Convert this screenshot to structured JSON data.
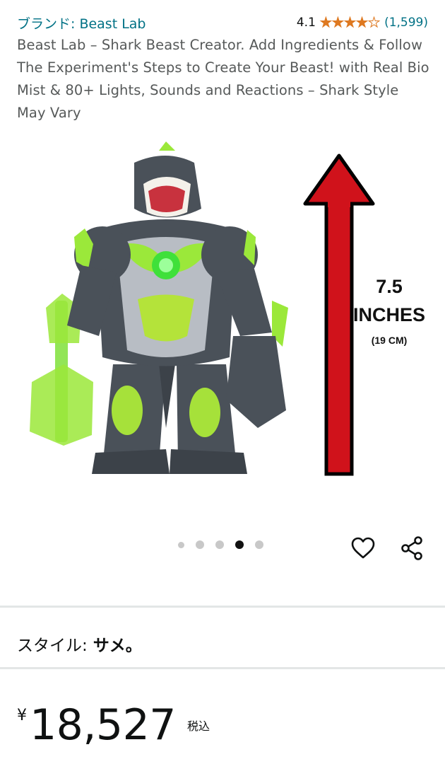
{
  "header": {
    "brand_link": "ブランド: Beast Lab",
    "rating_value": "4.1",
    "rating_count": "(1,599)",
    "rating_fraction": 0.82,
    "star_glyphs": "★★★★★"
  },
  "product": {
    "title": "Beast Lab – Shark Beast Creator. Add Ingredients & Follow The Experiment's Steps to Create Your Beast! with Real Bio Mist & 80+ Lights, Sounds and Reactions – Shark Style May Vary"
  },
  "image": {
    "size_value": "7.5",
    "size_unit": "INCHES",
    "size_cm": "(19 CM)"
  },
  "carousel": {
    "count": 5,
    "active_index": 3
  },
  "style": {
    "label": "スタイル:",
    "value": "サメ。"
  },
  "price": {
    "currency": "¥",
    "amount": "18,527",
    "tax_label": "税込"
  },
  "colors": {
    "link": "#007185",
    "star": "#de7921",
    "arrow_red": "#d0121b",
    "beast_gray": "#4a5159",
    "beast_green": "#9be83a"
  },
  "icons": {
    "wishlist": "heart-icon",
    "share": "share-icon"
  }
}
